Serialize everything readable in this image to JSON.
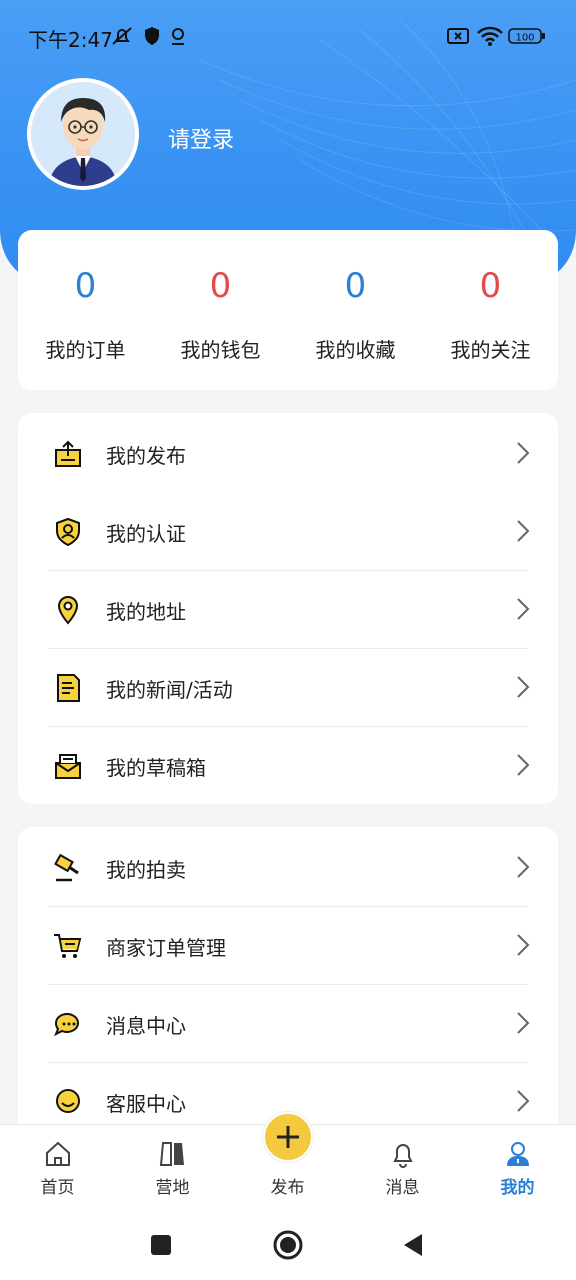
{
  "status_bar": {
    "time": "下午2:47",
    "battery": "100"
  },
  "profile": {
    "login_text": "请登录"
  },
  "stats": [
    {
      "value": "0",
      "label": "我的订单",
      "color": "#2a7fd6"
    },
    {
      "value": "0",
      "label": "我的钱包",
      "color": "#e04b4b"
    },
    {
      "value": "0",
      "label": "我的收藏",
      "color": "#2a7fd6"
    },
    {
      "value": "0",
      "label": "我的关注",
      "color": "#e04b4b"
    }
  ],
  "menu_group1": [
    {
      "label": "我的发布",
      "icon": "upload-icon"
    },
    {
      "label": "我的认证",
      "icon": "shield-user-icon"
    },
    {
      "label": "我的地址",
      "icon": "location-pin-icon"
    },
    {
      "label": "我的新闻/活动",
      "icon": "document-icon"
    },
    {
      "label": "我的草稿箱",
      "icon": "mailbox-icon"
    }
  ],
  "menu_group2": [
    {
      "label": "我的拍卖",
      "icon": "gavel-icon"
    },
    {
      "label": "商家订单管理",
      "icon": "cart-icon"
    },
    {
      "label": "消息中心",
      "icon": "chat-icon"
    },
    {
      "label": "客服中心",
      "icon": "smiley-icon"
    }
  ],
  "tabbar": {
    "items": [
      {
        "label": "首页",
        "icon": "home-icon"
      },
      {
        "label": "营地",
        "icon": "camp-icon"
      },
      {
        "label": "发布",
        "icon": "plus-icon"
      },
      {
        "label": "消息",
        "icon": "bell-icon"
      },
      {
        "label": "我的",
        "icon": "user-icon"
      }
    ],
    "active_color": "#2a7fd6",
    "accent": "#f4c940"
  }
}
